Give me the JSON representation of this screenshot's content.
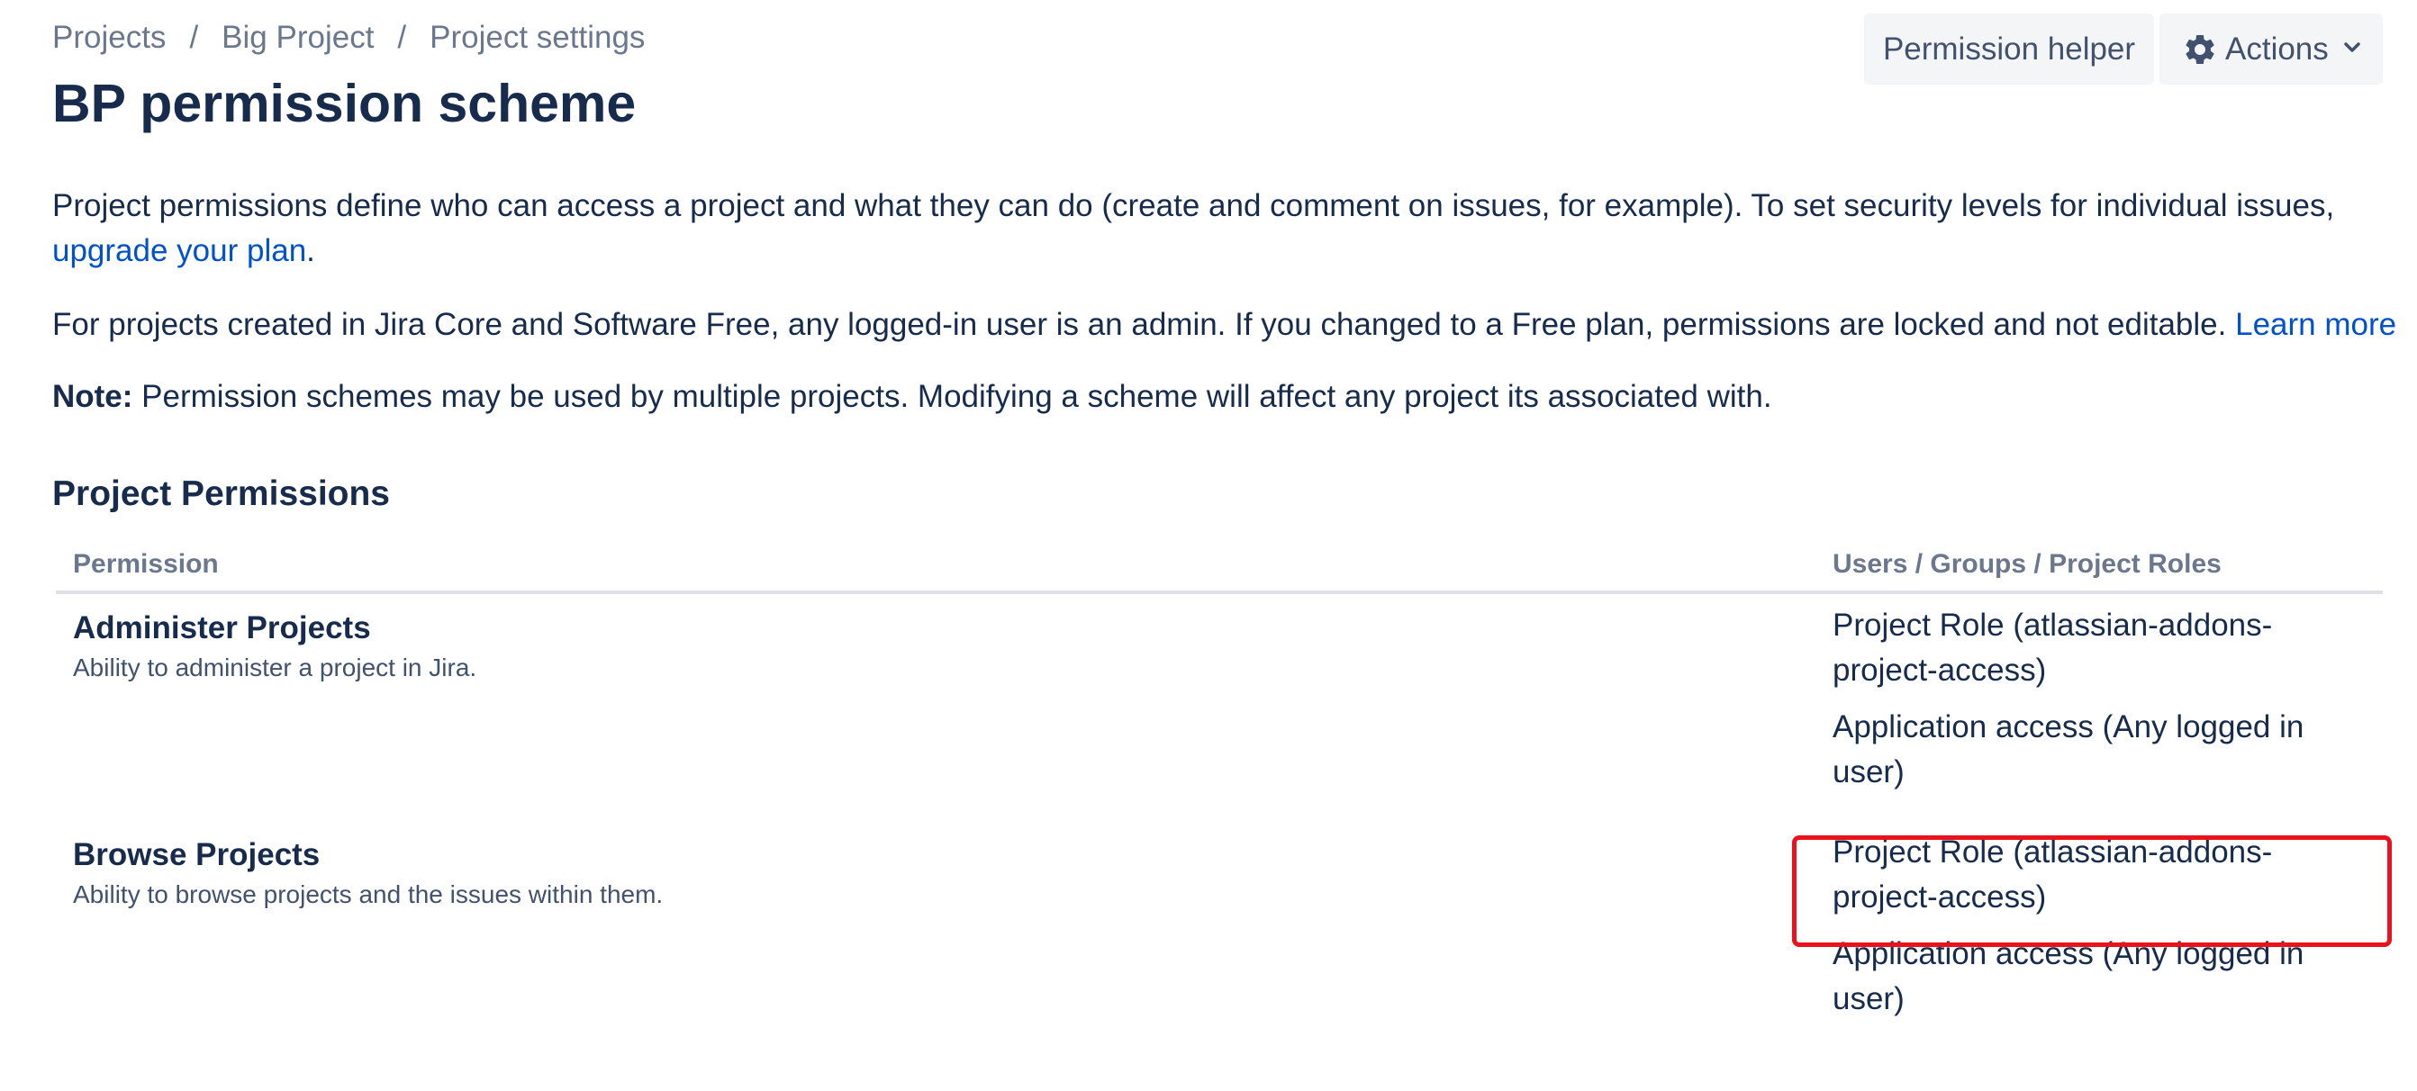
{
  "breadcrumb": {
    "items": [
      "Projects",
      "Big Project",
      "Project settings"
    ],
    "separator": "/"
  },
  "page_title": "BP permission scheme",
  "toolbar": {
    "helper_label": "Permission helper",
    "actions_label": "Actions",
    "actions_icon": "gear-icon",
    "actions_chevron_icon": "chevron-down-icon"
  },
  "description": {
    "para1_text": "Project permissions define who can access a project and what they can do (create and comment on issues, for example). To set security levels for individual issues,",
    "para1_link": "upgrade your plan",
    "para1_suffix": ".",
    "para2_text": "For projects created in Jira Core and Software Free, any logged-in user is an admin. If you changed to a Free plan, permissions are locked and not editable.",
    "para2_link": "Learn more",
    "note_label": "Note:",
    "note_text": "Permission schemes may be used by multiple projects. Modifying a scheme will affect any project its associated with."
  },
  "section_title": "Project Permissions",
  "table": {
    "headers": {
      "permission": "Permission",
      "grants": "Users / Groups / Project Roles"
    },
    "rows": [
      {
        "name": "Administer Projects",
        "description": "Ability to administer a project in Jira.",
        "grants": [
          "Project Role (atlassian-addons-project-access)",
          "Application access (Any logged in user)"
        ]
      },
      {
        "name": "Browse Projects",
        "description": "Ability to browse projects and the issues within them.",
        "grants": [
          "Project Role (atlassian-addons-project-access)",
          "Application access (Any logged in user)"
        ]
      }
    ]
  },
  "colors": {
    "text_primary": "#172b4d",
    "text_subtle": "#6b778c",
    "link": "#0052cc",
    "button_bg": "#f4f5f7",
    "highlight": "#e8131c"
  }
}
